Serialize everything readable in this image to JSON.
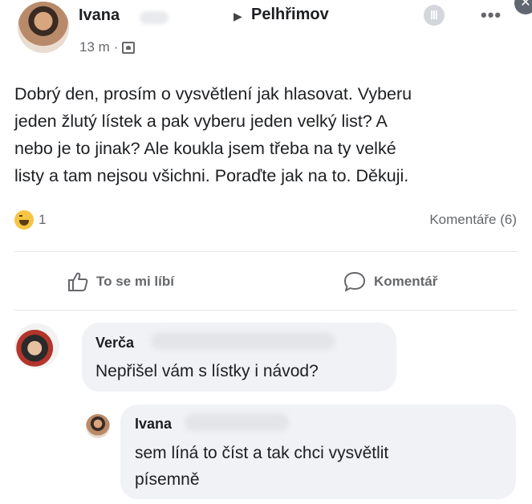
{
  "post": {
    "author": "Ivana",
    "group": "Pelhřimov",
    "time": "13 m",
    "separator": "·",
    "text": "Dobrý den, prosím o vysvětlení jak hlasovat. Vyberu\njeden žlutý lístek a pak vyberu jeden velký list? A\nnebo je to jinak? Ale koukla jsem třeba na ty velké\nlisty a tam  nejsou všichni. Poraďte jak na to. Děkuji.",
    "reaction_count": "1",
    "comments_label": "Komentáře (6)"
  },
  "actions": {
    "like_label": "To se mi líbí",
    "comment_label": "Komentář"
  },
  "comments": [
    {
      "author": "Verča",
      "text": "Nepřišel vám s lístky i návod?"
    },
    {
      "author": "Ivana",
      "text": "sem líná to číst a tak chci  vysvětlit\npísemně"
    }
  ],
  "icons": {
    "group_arrow": "caret-right-icon",
    "audience": "group-audience-icon",
    "reaction": "haha-reaction-icon",
    "like": "thumbs-up-icon",
    "comment": "speech-bubble-icon",
    "more": "more-options-icon",
    "stats": "insights-icon",
    "close": "close-icon"
  },
  "colors": {
    "text": "#1c1e21",
    "secondary": "#65676b",
    "bubble": "#f0f2f5",
    "divider": "#e4e6eb",
    "reaction": "#f7c544"
  }
}
